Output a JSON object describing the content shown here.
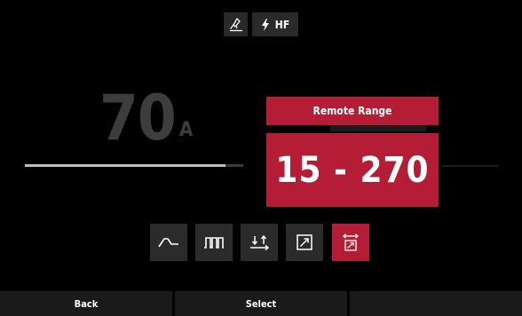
{
  "status_bar": {
    "torch_icon": "torch-icon",
    "hf_icon": "lightning-icon",
    "hf_label": "HF"
  },
  "readout": {
    "value": "70",
    "unit": "A",
    "level": 0.92
  },
  "popup": {
    "title": "Remote Range",
    "range": "15 - 270"
  },
  "modes": [
    {
      "icon": "pulse-ramp-icon",
      "active": false
    },
    {
      "icon": "square-wave-icon",
      "active": false
    },
    {
      "icon": "two-arrows-up-icon",
      "active": false
    },
    {
      "icon": "diagonal-arrow-box-icon",
      "active": false
    },
    {
      "icon": "remote-range-icon",
      "active": true
    }
  ],
  "softkeys": {
    "back": "Back",
    "select": "Select",
    "third": ""
  },
  "colors": {
    "accent": "#b51d36",
    "button": "#2b2b2b",
    "dim_text": "#3d3d3d"
  }
}
